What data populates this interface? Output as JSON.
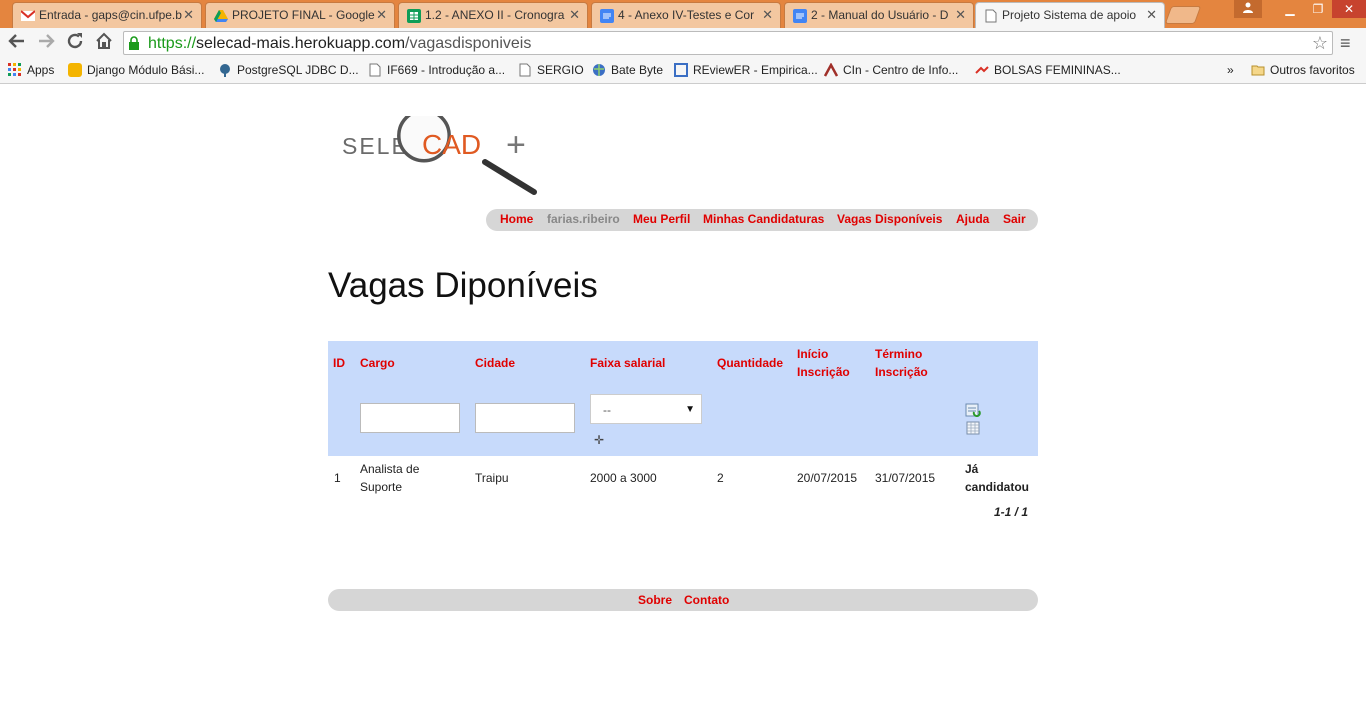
{
  "browser": {
    "tabs": [
      {
        "title": "Entrada - gaps@cin.ufpe.b",
        "icon": "gmail-icon",
        "color": "#d93025"
      },
      {
        "title": "PROJETO FINAL - Google",
        "icon": "drive-icon",
        "color": "#f4b400"
      },
      {
        "title": "1.2 - ANEXO II - Cronogra",
        "icon": "sheets-icon",
        "color": "#0f9d58"
      },
      {
        "title": "4 - Anexo IV-Testes e Cor",
        "icon": "docs-icon",
        "color": "#4285f4"
      },
      {
        "title": "2 - Manual do Usuário - D",
        "icon": "docs-icon",
        "color": "#4285f4"
      },
      {
        "title": "Projeto Sistema de apoio",
        "icon": "page-icon",
        "color": "#ffffff"
      }
    ],
    "url_scheme": "https://",
    "url_host": "selecad-mais.herokuapp.com",
    "url_path": "/vagasdisponiveis",
    "bookmarks": [
      {
        "label": "Apps",
        "icon": "apps-icon"
      },
      {
        "label": "Django Módulo Bási...",
        "icon": "bookmark-icon"
      },
      {
        "label": "PostgreSQL JDBC D...",
        "icon": "postgres-icon"
      },
      {
        "label": "IF669 - Introdução a...",
        "icon": "page-icon"
      },
      {
        "label": "SERGIO",
        "icon": "page-icon"
      },
      {
        "label": "Bate Byte",
        "icon": "globe-icon"
      },
      {
        "label": "REviewER - Empirica...",
        "icon": "bookmark-icon"
      },
      {
        "label": "CIn - Centro de Info...",
        "icon": "cin-icon"
      },
      {
        "label": "BOLSAS FEMININAS...",
        "icon": "bookmark-icon"
      }
    ],
    "overflow": "»",
    "other_bookmarks": "Outros favoritos"
  },
  "site": {
    "logo_text_left": "SELE",
    "logo_text_mid": "CAD",
    "logo_text_right": "+",
    "nav": {
      "home": "Home",
      "user": "farias.ribeiro",
      "profile": "Meu Perfil",
      "applications": "Minhas Candidaturas",
      "jobs": "Vagas Disponíveis",
      "help": "Ajuda",
      "logout": "Sair"
    },
    "page_title": "Vagas Diponíveis",
    "table": {
      "headers": {
        "id": "ID",
        "cargo": "Cargo",
        "cidade": "Cidade",
        "faixa": "Faixa salarial",
        "quantidade": "Quantidade",
        "inicio_1": "Início",
        "inicio_2": "Inscrição",
        "termino_1": "Término",
        "termino_2": "Inscrição"
      },
      "filter_select_value": "--",
      "rows": [
        {
          "id": "1",
          "cargo_1": "Analista de",
          "cargo_2": "Suporte",
          "cidade": "Traipu",
          "faixa": "2000 a 3000",
          "quantidade": "2",
          "inicio": "20/07/2015",
          "termino": "31/07/2015",
          "status_1": "Já",
          "status_2": "candidatou"
        }
      ],
      "pager": "1-1 / 1"
    },
    "footer": {
      "about": "Sobre",
      "contact": "Contato"
    },
    "colors": {
      "link": "#e00000",
      "header_bg": "#c7dafb",
      "bar_bg": "#d6d6d6"
    }
  }
}
